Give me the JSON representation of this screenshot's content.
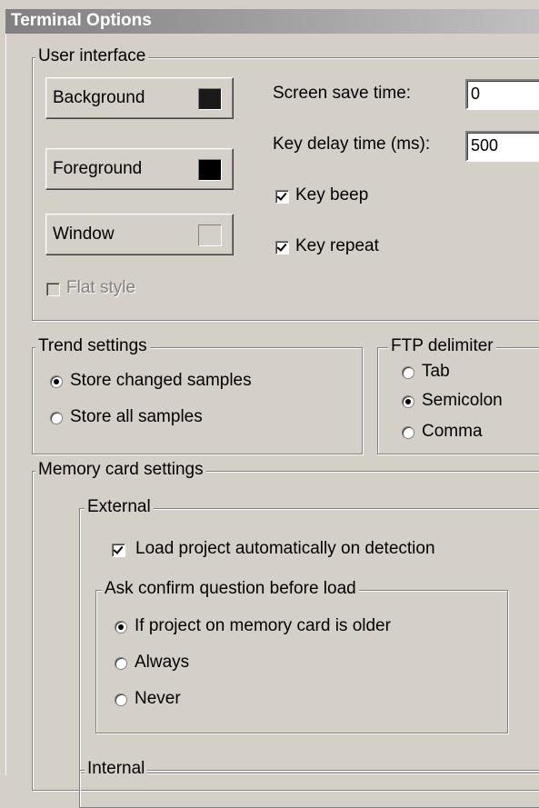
{
  "window": {
    "title": "Terminal Options"
  },
  "user_interface": {
    "legend": "User interface",
    "background_label": "Background",
    "background_color": "#1a1a1a",
    "foreground_label": "Foreground",
    "foreground_color": "#000000",
    "window_label": "Window",
    "window_color": "#d4d0c8",
    "flat_style_label": "Flat style",
    "screen_save_label": "Screen save time:",
    "screen_save_value": "0",
    "key_delay_label": "Key delay time (ms):",
    "key_delay_value": "500",
    "key_beep_label": "Key beep",
    "key_repeat_label": "Key repeat"
  },
  "trend_settings": {
    "legend": "Trend settings",
    "options": [
      "Store changed samples",
      "Store all samples"
    ],
    "selected": "Store changed samples"
  },
  "ftp_delimiter": {
    "legend": "FTP delimiter",
    "options": [
      "Tab",
      "Semicolon",
      "Comma"
    ],
    "selected": "Semicolon"
  },
  "memory_card": {
    "legend": "Memory card settings",
    "external": {
      "legend": "External",
      "load_auto_label": "Load project automatically on detection",
      "confirm": {
        "legend": "Ask confirm question before load",
        "options": [
          "If project on memory card is older",
          "Always",
          "Never"
        ],
        "selected": "If project on memory card is older"
      }
    },
    "internal": {
      "legend": "Internal"
    }
  }
}
